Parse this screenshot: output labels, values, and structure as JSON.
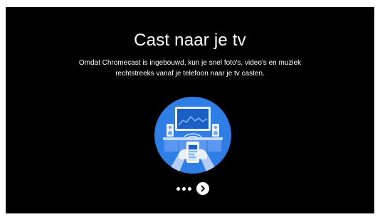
{
  "screen": {
    "title": "Cast naar je tv",
    "description_lines": [
      "Omdat Chromecast is ingebouwd, kun je snel foto's, video's en muziek",
      "rechtstreeks vanaf je telefoon naar je tv casten."
    ],
    "illustration_icon": "cast-to-tv-illustration-icon",
    "pager": {
      "dots": 3,
      "next_icon": "chevron-right-icon"
    }
  },
  "colors": {
    "background": "#000000",
    "text": "#ffffff",
    "accent_blue": "#2f7ee6"
  }
}
